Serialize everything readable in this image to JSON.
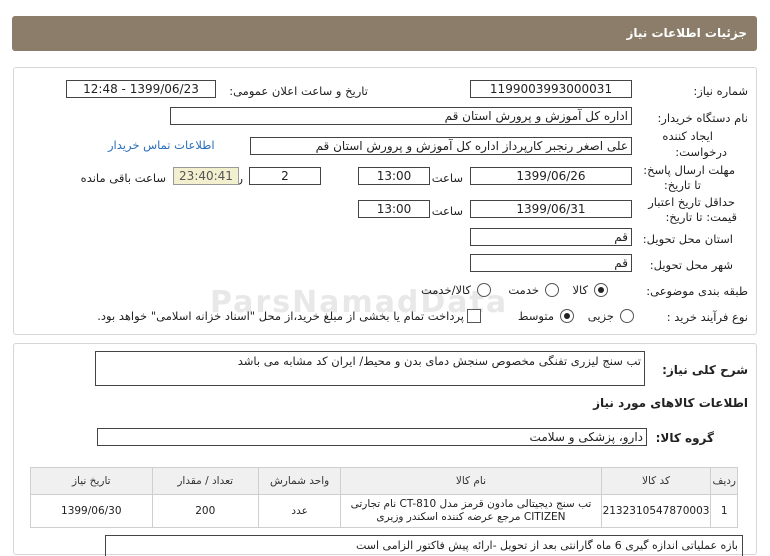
{
  "header": {
    "title": "جزئیات اطلاعات نیاز"
  },
  "form": {
    "need_number_label": "شماره نیاز:",
    "need_number": "1199003993000031",
    "announce_label": "تاریخ و ساعت اعلان عمومی:",
    "announce_value": "1399/06/23 - 12:48",
    "buyer_org_label": "نام دستگاه خریدار:",
    "buyer_org": "اداره کل آموزش و پرورش استان قم",
    "requester_label_1": "ایجاد کننده",
    "requester_label_2": "درخواست:",
    "requester": "علی اصغر رنجبر کارپرداز اداره کل آموزش و پرورش استان قم",
    "contact_link": "اطلاعات تماس خریدار",
    "deadline_label_1": "مهلت ارسال پاسخ:",
    "deadline_label_2": "تا تاریخ:",
    "deadline_date": "1399/06/26",
    "time_label": "ساعت",
    "deadline_time": "13:00",
    "days_value": "2",
    "days_label": "روز و",
    "remaining_time": "23:40:41",
    "remaining_label": "ساعت باقی مانده",
    "validity_label_1": "حداقل تاریخ اعتبار",
    "validity_label_2": "قیمت: تا تاریخ:",
    "validity_date": "1399/06/31",
    "validity_time": "13:00",
    "province_label": "استان محل تحویل:",
    "province": "قم",
    "city_label": "شهر محل تحویل:",
    "city": "قم",
    "category_label": "طبقه بندی موضوعی:",
    "category_options": [
      "کالا",
      "خدمت",
      "کالا/خدمت"
    ],
    "process_label": "نوع فرآیند خرید :",
    "process_options": [
      "جزیی",
      "متوسط"
    ],
    "payment_note": "پرداخت تمام یا بخشی از مبلغ خرید،از محل \"اسناد خزانه اسلامی\" خواهد بود."
  },
  "general": {
    "desc_label": "شرح کلی نیاز:",
    "desc_value": "تب سنج لیزری تفنگی مخصوص سنجش دمای بدن و محیط/ ایران کد مشابه می باشد",
    "goods_title": "اطلاعات کالاهای مورد نیاز",
    "group_label": "گروه کالا:",
    "group_value": "دارو، پزشکی و سلامت"
  },
  "table": {
    "headers": [
      "ردیف",
      "کد کالا",
      "نام کالا",
      "واحد شمارش",
      "تعداد / مقدار",
      "تاریخ نیاز"
    ],
    "rows": [
      {
        "index": "1",
        "code": "2132310547870003",
        "name_line1": "تب سنج دیجیتالی مادون قرمز مدل CT-810 نام تجارتی",
        "name_line2": "CITIZEN مرجع عرضه کننده اسکندر وزیری",
        "unit": "عدد",
        "qty": "200",
        "date": "1399/06/30"
      }
    ]
  },
  "bottom_note": "بازه عملیاتی اندازه گیری 6 ماه گارانتی بعد از تحویل -ارائه پیش فاکتور الزامی است"
}
